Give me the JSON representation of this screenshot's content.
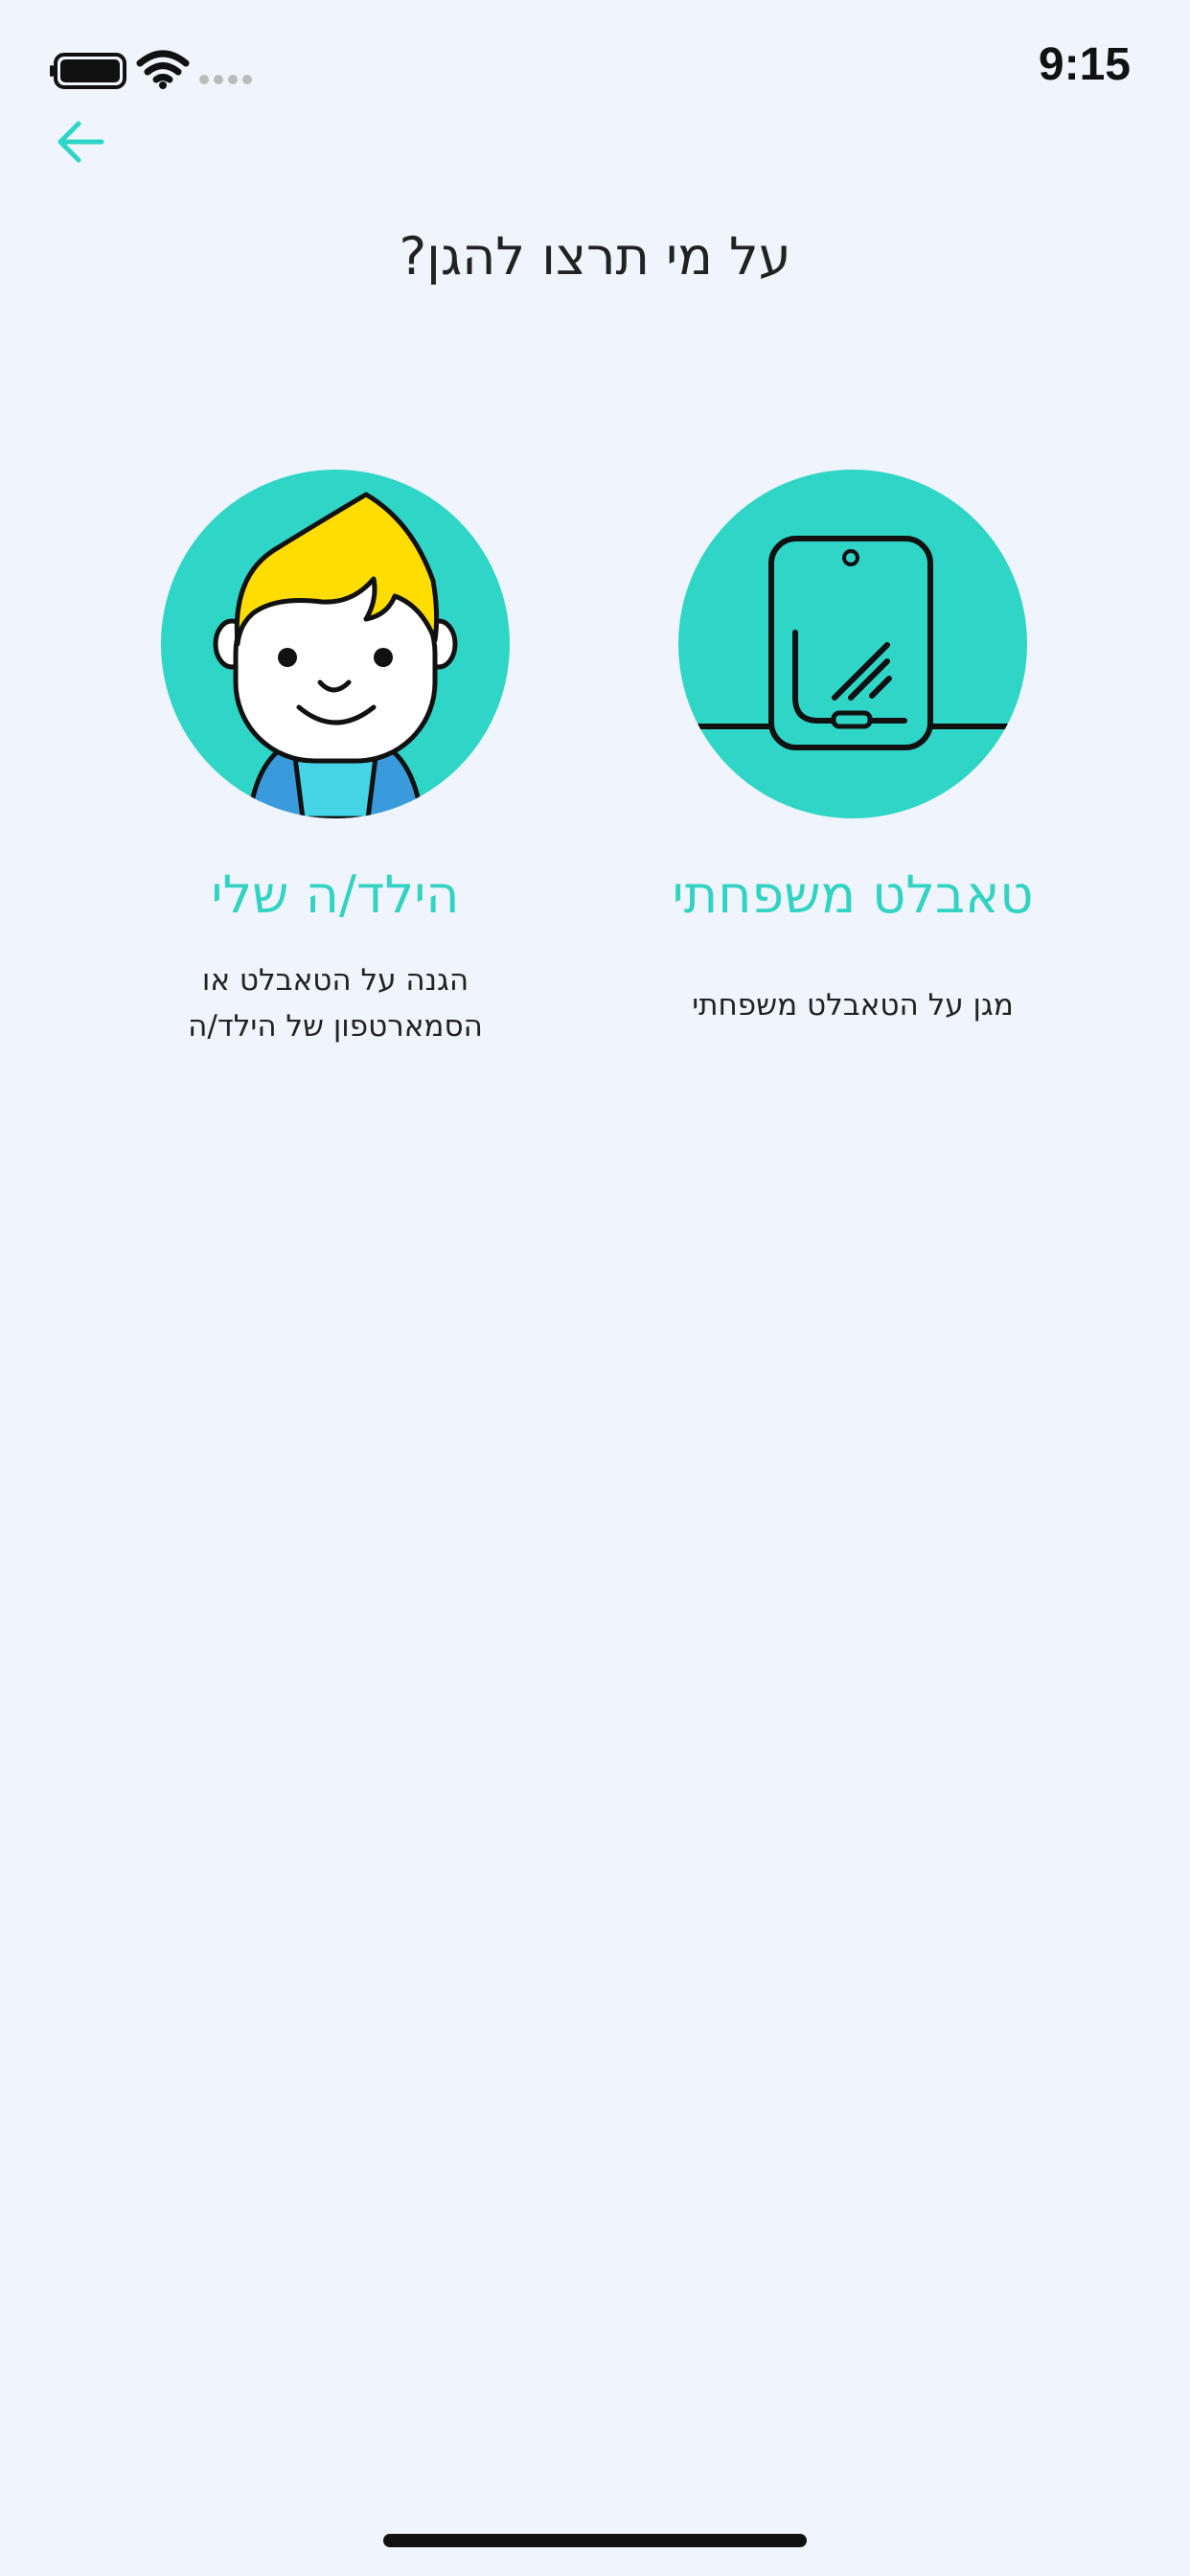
{
  "status_bar": {
    "time": "9:15",
    "icons": [
      "battery-icon",
      "wifi-icon",
      "cellular-signal-icon"
    ]
  },
  "header": {
    "back_icon": "arrow-left-icon",
    "title": "על מי תרצו להגן?"
  },
  "options": [
    {
      "id": "family-tablet",
      "icon": "tablet-icon",
      "label": "טאבלט משפחתי",
      "description": "מגן על הטאבלט משפחתי"
    },
    {
      "id": "my-child",
      "icon": "child-avatar-icon",
      "label": "הילד/ה שלי",
      "description_lines": [
        "הגנה על הטאבלט או",
        "הסמארטפון של הילד/ה"
      ]
    }
  ],
  "colors": {
    "background": "#F0F4FC",
    "accent": "#2FD6C8",
    "accent_text": "#33D3C4",
    "text_primary": "#222222",
    "hair": "#FFDD00",
    "jacket": "#3A9BDC"
  }
}
